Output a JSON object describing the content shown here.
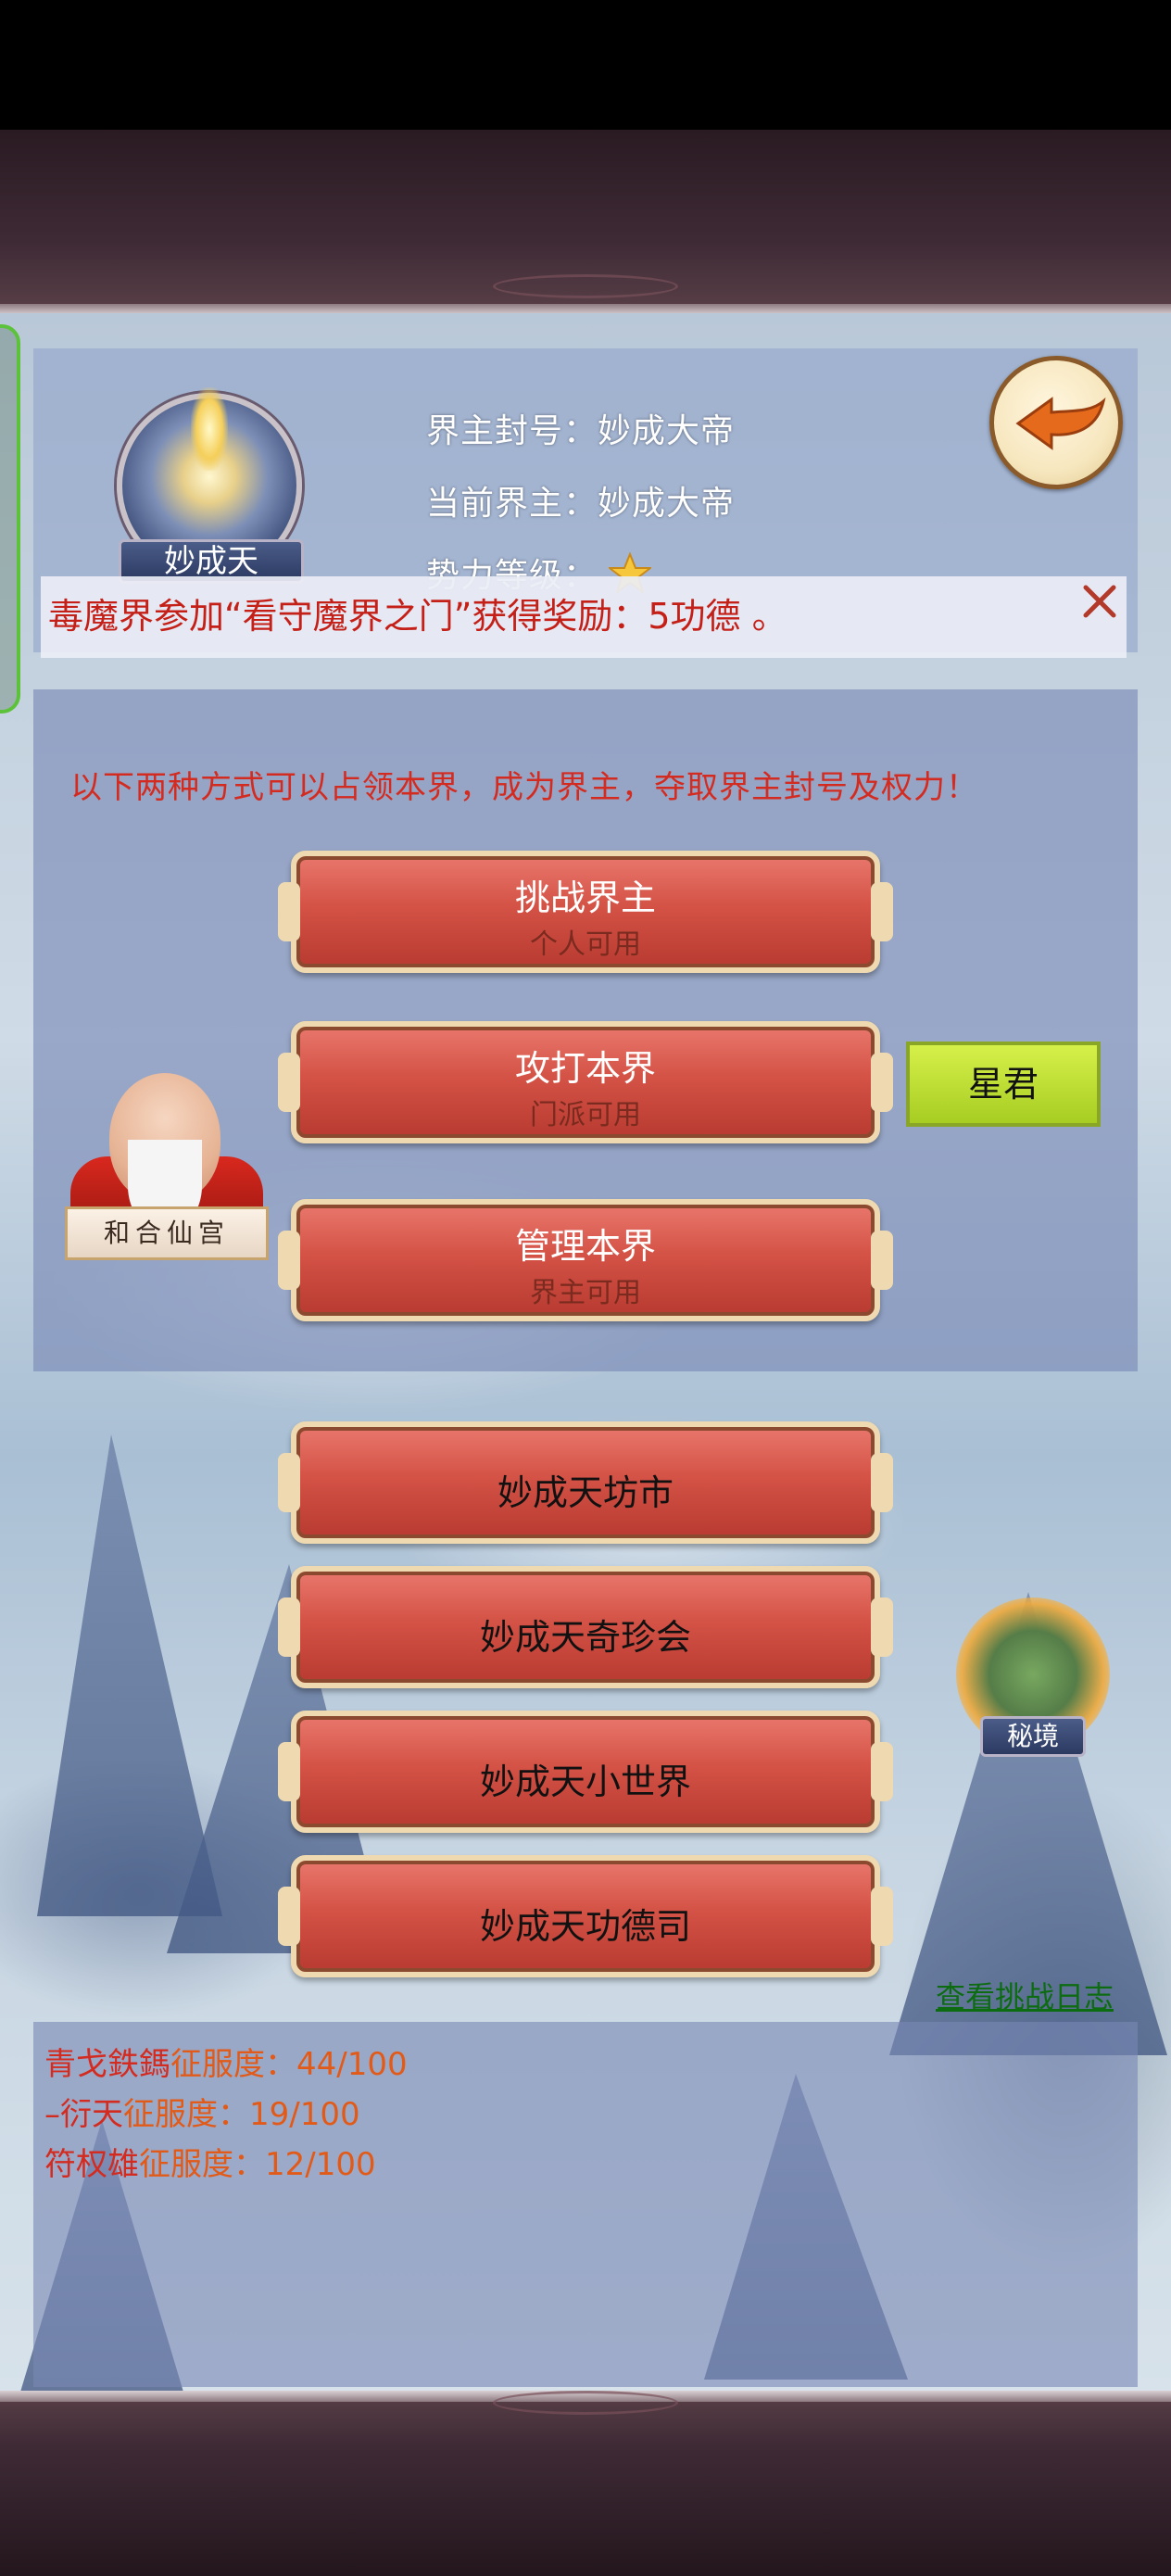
{
  "header": {
    "avatar_name": "妙成天",
    "title_line": "界主封号：妙成大帝",
    "current_lord_line": "当前界主：妙成大帝",
    "power_level_line": "势力等级：",
    "power_level_stars": 1
  },
  "ticker": {
    "message": "毒魔界参加“看守魔界之门”获得奖励：5功德 。"
  },
  "main": {
    "instruction": "以下两种方式可以占领本界，成为界主，夺取界主封号及权力！",
    "buttons": [
      {
        "label": "挑战界主",
        "sub": "个人可用"
      },
      {
        "label": "攻打本界",
        "sub": "门派可用"
      },
      {
        "label": "管理本界",
        "sub": "界主可用"
      }
    ],
    "star_button": "星君",
    "npc_label": "和合仙宫"
  },
  "shop_buttons": [
    {
      "label": "妙成天坊市"
    },
    {
      "label": "妙成天奇珍会"
    },
    {
      "label": "妙成天小世界"
    },
    {
      "label": "妙成天功德司"
    }
  ],
  "secret_realm_label": "秘境",
  "log_link": "查看挑战日志",
  "conquest": [
    {
      "name": "青戈鉄鎷",
      "label": "征服度：",
      "value": "44/100"
    },
    {
      "name": "–衍天",
      "label": "征服度：",
      "value": "19/100"
    },
    {
      "name": "符权雄",
      "label": "征服度：",
      "value": "12/100"
    }
  ],
  "colors": {
    "accent_red": "#d32b20",
    "button_red": "#d45246",
    "button_border": "#efd9b0",
    "star_button": "#c3e23a",
    "link_green": "#0d6b12"
  }
}
